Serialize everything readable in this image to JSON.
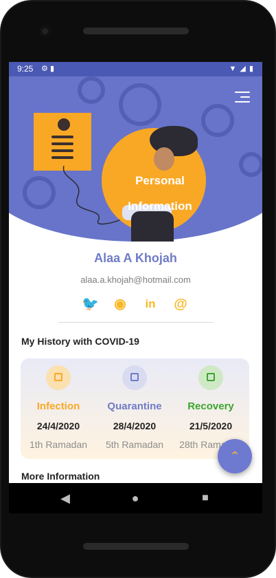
{
  "statusbar": {
    "time": "9:25",
    "left_icons": [
      "settings-icon",
      "sd-card-icon"
    ],
    "right_icons": [
      "wifi-icon",
      "signal-icon",
      "battery-icon"
    ]
  },
  "hero": {
    "title_line1": "Personal",
    "title_line2": "Information",
    "menu_icon": "menu-icon"
  },
  "profile": {
    "name": "Alaa A Khojah",
    "email": "alaa.a.khojah@hotmail.com"
  },
  "socials": [
    {
      "icon": "twitter-icon",
      "glyph": "🐦"
    },
    {
      "icon": "github-icon",
      "glyph": "◉"
    },
    {
      "icon": "linkedin-icon",
      "glyph": "in"
    },
    {
      "icon": "email-at-icon",
      "glyph": "@"
    }
  ],
  "history": {
    "title": "My History with COVID-19",
    "columns": [
      {
        "label": "Infection",
        "date": "24/4/2020",
        "ramadan": "1th Ramadan",
        "color": "#f9a825",
        "circle": "#fbe0b0",
        "icon": "calendar-icon"
      },
      {
        "label": "Quarantine",
        "date": "28/4/2020",
        "ramadan": "5th Ramadan",
        "color": "#6f7bc6",
        "circle": "#d9dcf1",
        "icon": "calendar-icon"
      },
      {
        "label": "Recovery",
        "date": "21/5/2020",
        "ramadan": "28th Ramadan",
        "color": "#3aa62e",
        "circle": "#cfe9c6",
        "icon": "calendar-icon"
      }
    ]
  },
  "more": {
    "title": "More Information"
  },
  "fab": {
    "glyph": "⌃",
    "icon": "chevron-up-icon"
  },
  "navbar": {
    "back": "◀",
    "home": "●",
    "recents": "■"
  },
  "colors": {
    "primary": "#6774c9",
    "accent": "#f9a825",
    "statusbar": "#4a59b3"
  }
}
